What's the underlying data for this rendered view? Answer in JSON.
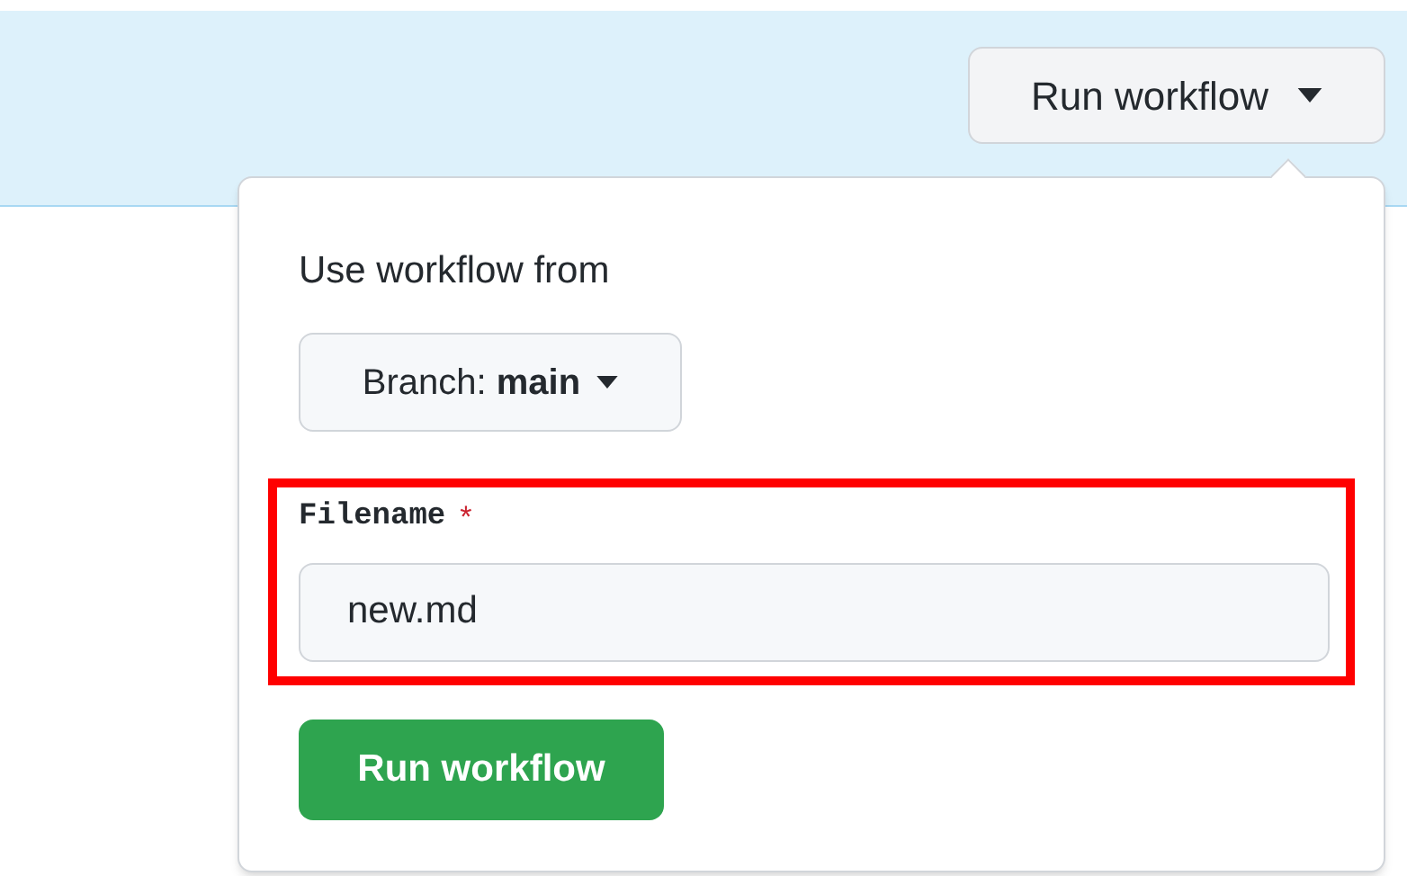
{
  "header": {
    "run_button": "Run workflow"
  },
  "popover": {
    "heading": "Use workflow from",
    "branch_button": "Branch: **main**",
    "field": {
      "label": "Filename",
      "required": true,
      "required_mark": "*",
      "value": "new.md",
      "highlighted": true
    },
    "submit_button": "Run workflow"
  }
}
